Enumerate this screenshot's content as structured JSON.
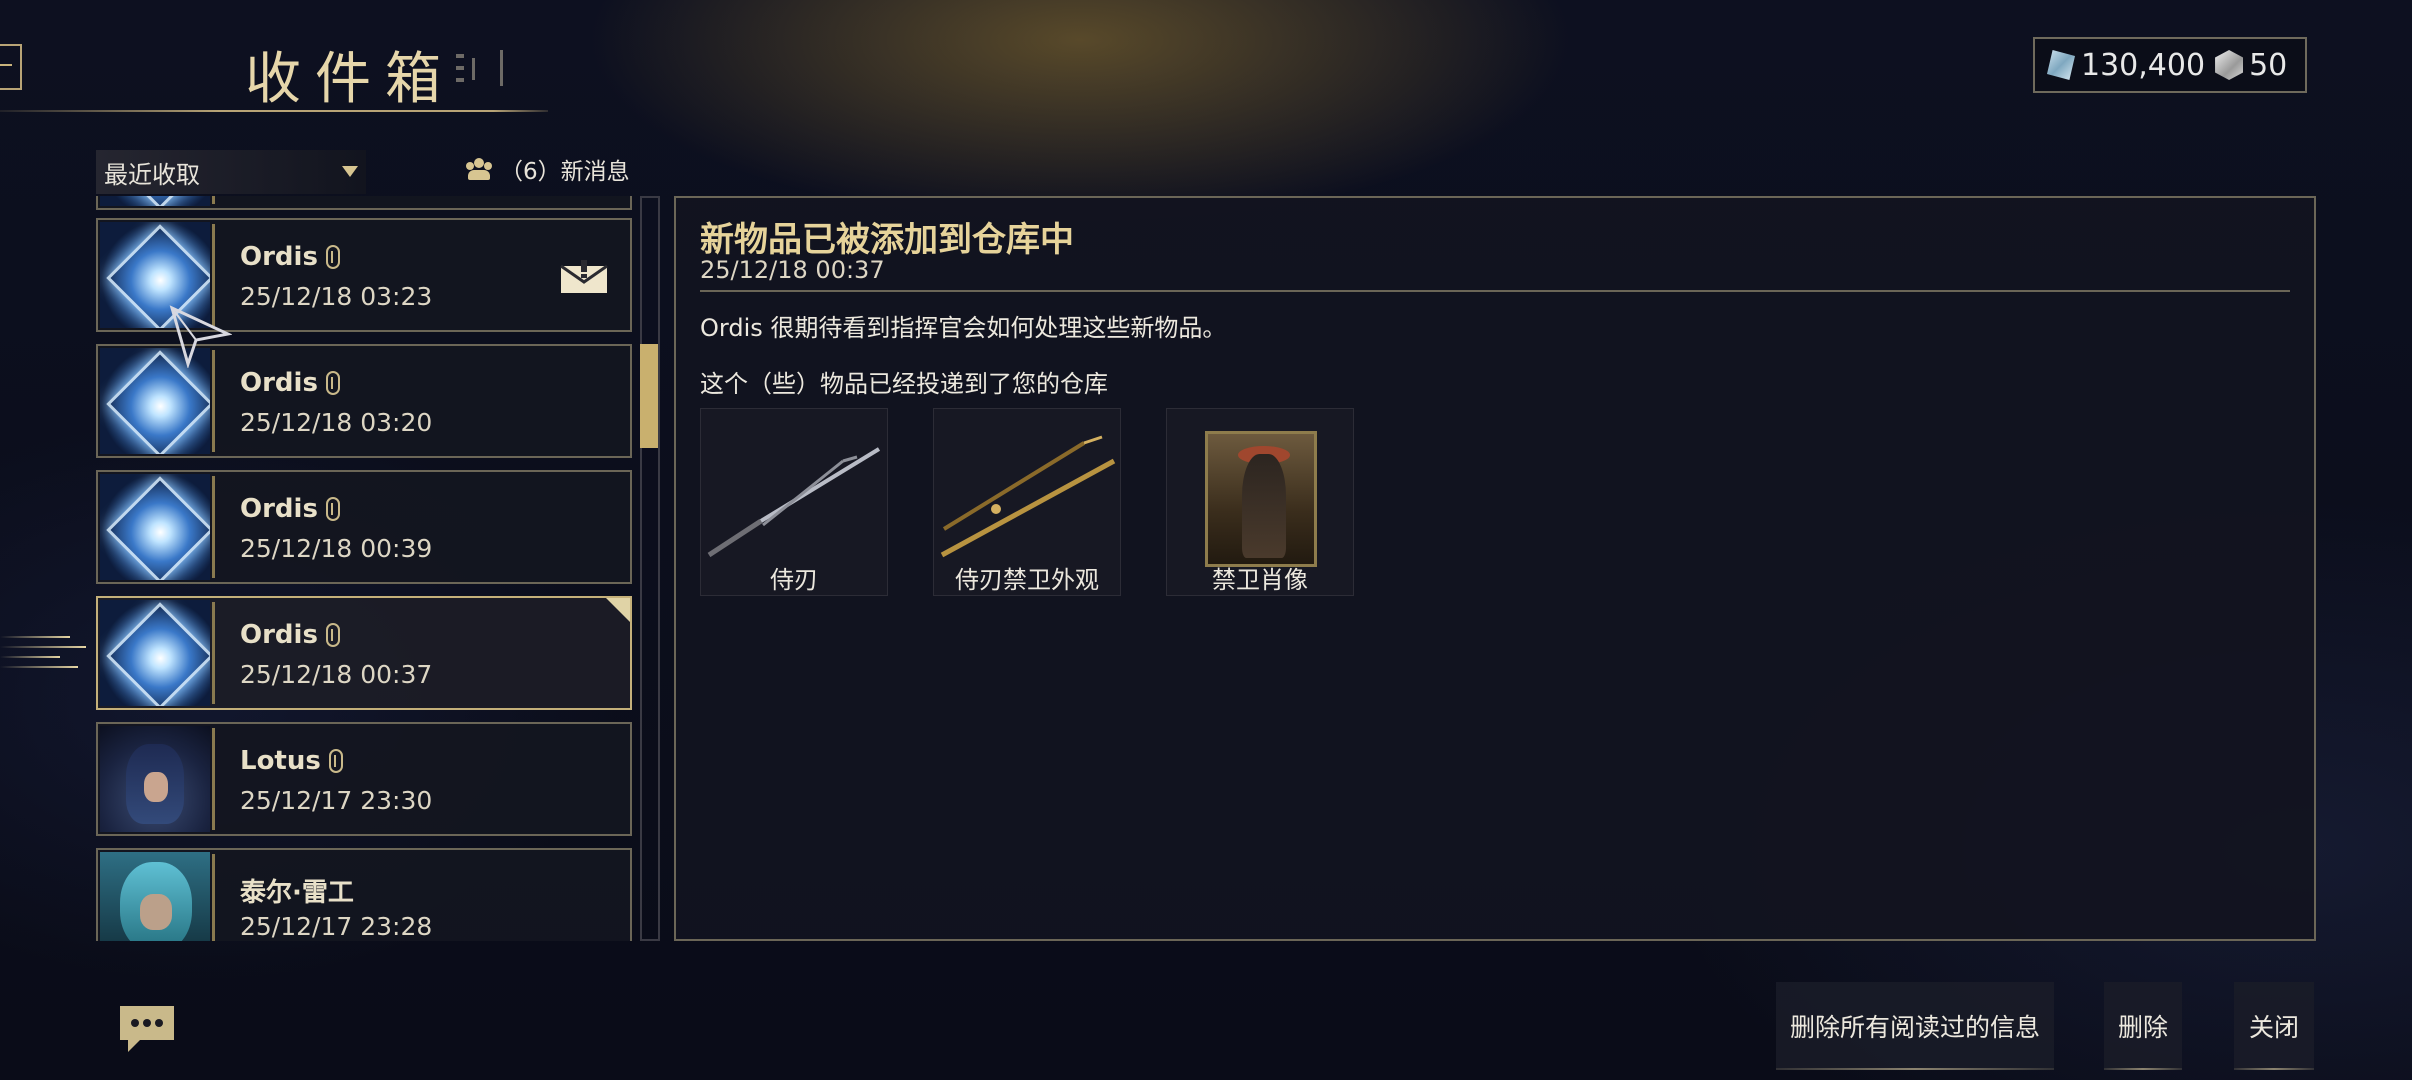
{
  "header": {
    "title": "收件箱",
    "back_label": ""
  },
  "currency": {
    "platinum_value": "130,400",
    "credits_value": "50",
    "platinum_icon": "platinum-icon",
    "credits_icon": "credits-icon"
  },
  "filter": {
    "sort_selected": "最近收取",
    "new_messages_label": "（6）新消息"
  },
  "messages": [
    {
      "sender": "Ordis",
      "date": "25/12/18 03:23",
      "has_attachment": true,
      "unread": true
    },
    {
      "sender": "Ordis",
      "date": "25/12/18 03:20",
      "has_attachment": true,
      "unread": false
    },
    {
      "sender": "Ordis",
      "date": "25/12/18 00:39",
      "has_attachment": true,
      "unread": false
    },
    {
      "sender": "Ordis",
      "date": "25/12/18 00:37",
      "has_attachment": true,
      "unread": false,
      "selected": true
    },
    {
      "sender": "Lotus",
      "date": "25/12/17 23:30",
      "has_attachment": true,
      "unread": false
    },
    {
      "sender": "泰尔·雷工",
      "date": "25/12/17 23:28",
      "has_attachment": false,
      "unread": false
    }
  ],
  "detail": {
    "title": "新物品已被添加到仓库中",
    "date": "25/12/18 00:37",
    "body": "Ordis 很期待看到指挥官会如何处理这些新物品。",
    "delivered_label": "这个（些）物品已经投递到了您的仓库",
    "items": [
      {
        "label": "侍刃",
        "icon": "katana-icon"
      },
      {
        "label": "侍刃禁卫外观",
        "icon": "katana-skin-icon"
      },
      {
        "label": "禁卫肖像",
        "icon": "portrait-icon"
      }
    ]
  },
  "footer": {
    "delete_read_label": "删除所有阅读过的信息",
    "delete_label": "删除",
    "close_label": "关闭"
  },
  "colors": {
    "accent_gold": "#c9b06e",
    "panel_border": "#6b6657",
    "background": "#0b0d18"
  }
}
